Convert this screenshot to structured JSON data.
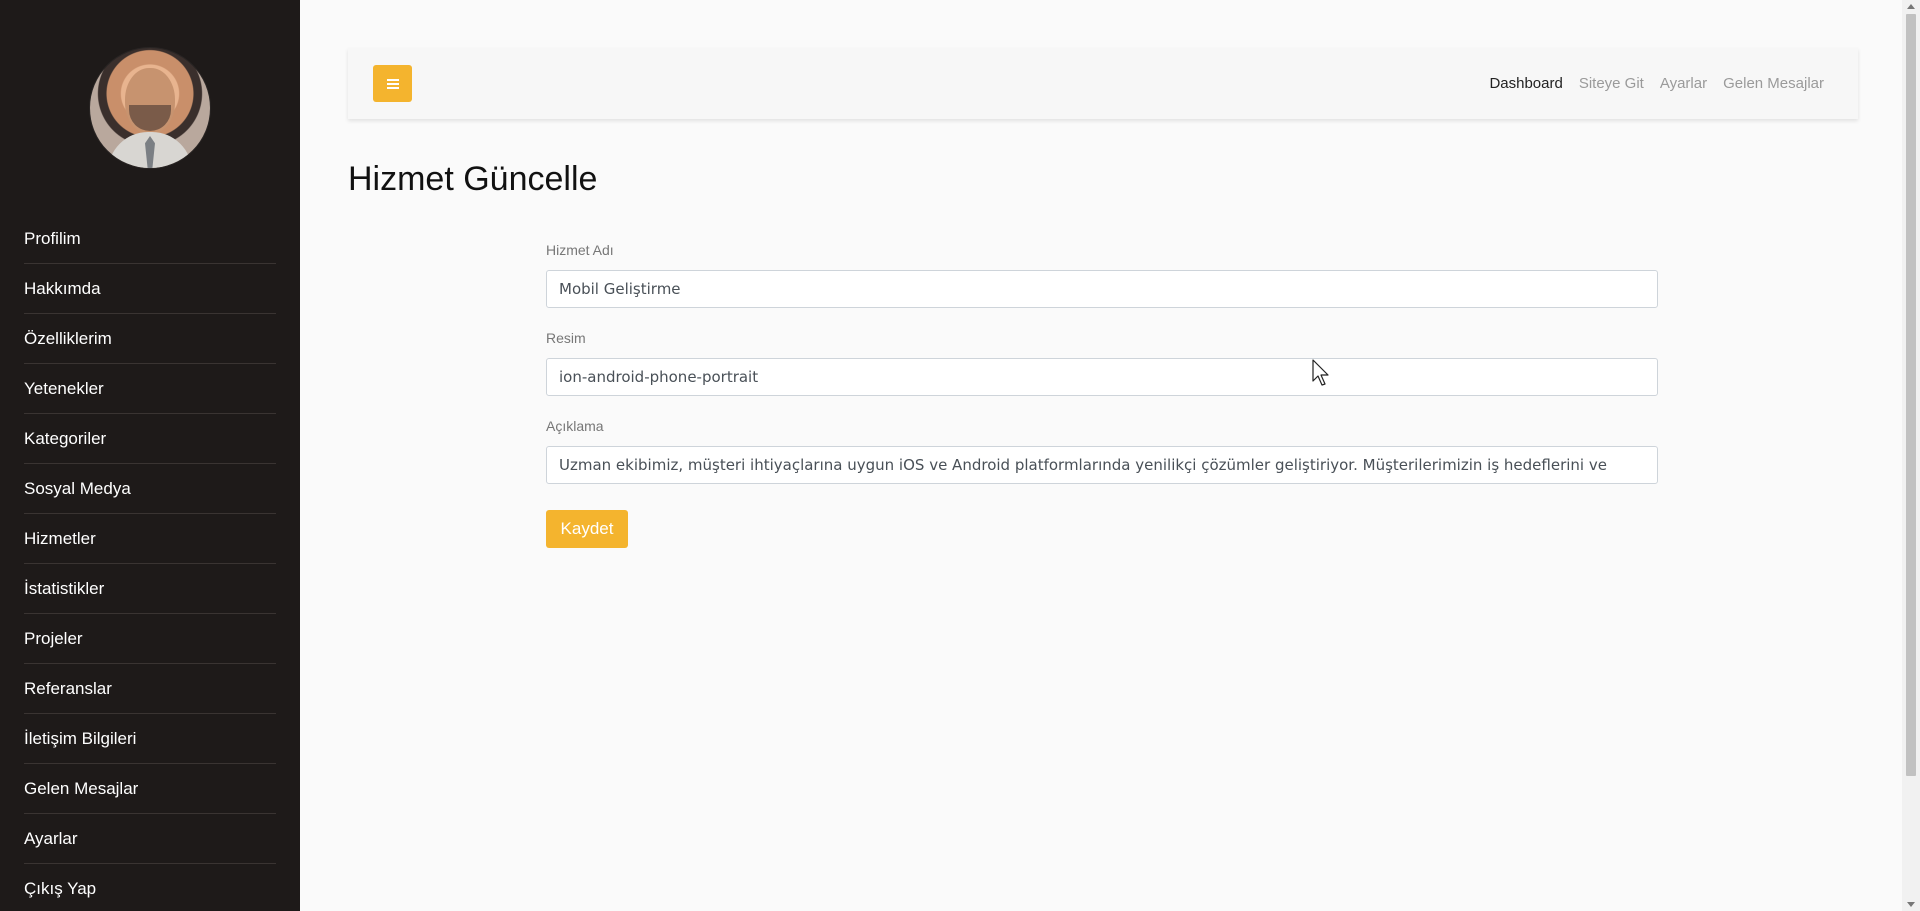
{
  "sidebar": {
    "avatar_alt": "Profile photo",
    "items": [
      {
        "label": "Profilim"
      },
      {
        "label": "Hakkımda"
      },
      {
        "label": "Özelliklerim"
      },
      {
        "label": "Yetenekler"
      },
      {
        "label": "Kategoriler"
      },
      {
        "label": "Sosyal Medya"
      },
      {
        "label": "Hizmetler"
      },
      {
        "label": "İstatistikler"
      },
      {
        "label": "Projeler"
      },
      {
        "label": "Referanslar"
      },
      {
        "label": "İletişim Bilgileri"
      },
      {
        "label": "Gelen Mesajlar"
      },
      {
        "label": "Ayarlar"
      },
      {
        "label": "Çıkış Yap"
      }
    ]
  },
  "topbar": {
    "toggle_icon": "hamburger-menu-icon",
    "nav": [
      {
        "label": "Dashboard",
        "active": true
      },
      {
        "label": "Siteye Git",
        "active": false
      },
      {
        "label": "Ayarlar",
        "active": false
      },
      {
        "label": "Gelen Mesajlar",
        "active": false
      }
    ]
  },
  "page": {
    "title": "Hizmet Güncelle"
  },
  "form": {
    "name_label": "Hizmet Adı",
    "name_value": "Mobil Geliştirme",
    "image_label": "Resim",
    "image_value": "ion-android-phone-portrait",
    "description_label": "Açıklama",
    "description_value": "Uzman ekibimiz, müşteri ihtiyaçlarına uygun iOS ve Android platformlarında yenilikçi çözümler geliştiriyor. Müşterilerimizin iş hedeflerini ve",
    "save_label": "Kaydet"
  },
  "colors": {
    "sidebar_bg": "#1e1a19",
    "accent": "#f4b42e",
    "page_bg": "#fafafa"
  }
}
